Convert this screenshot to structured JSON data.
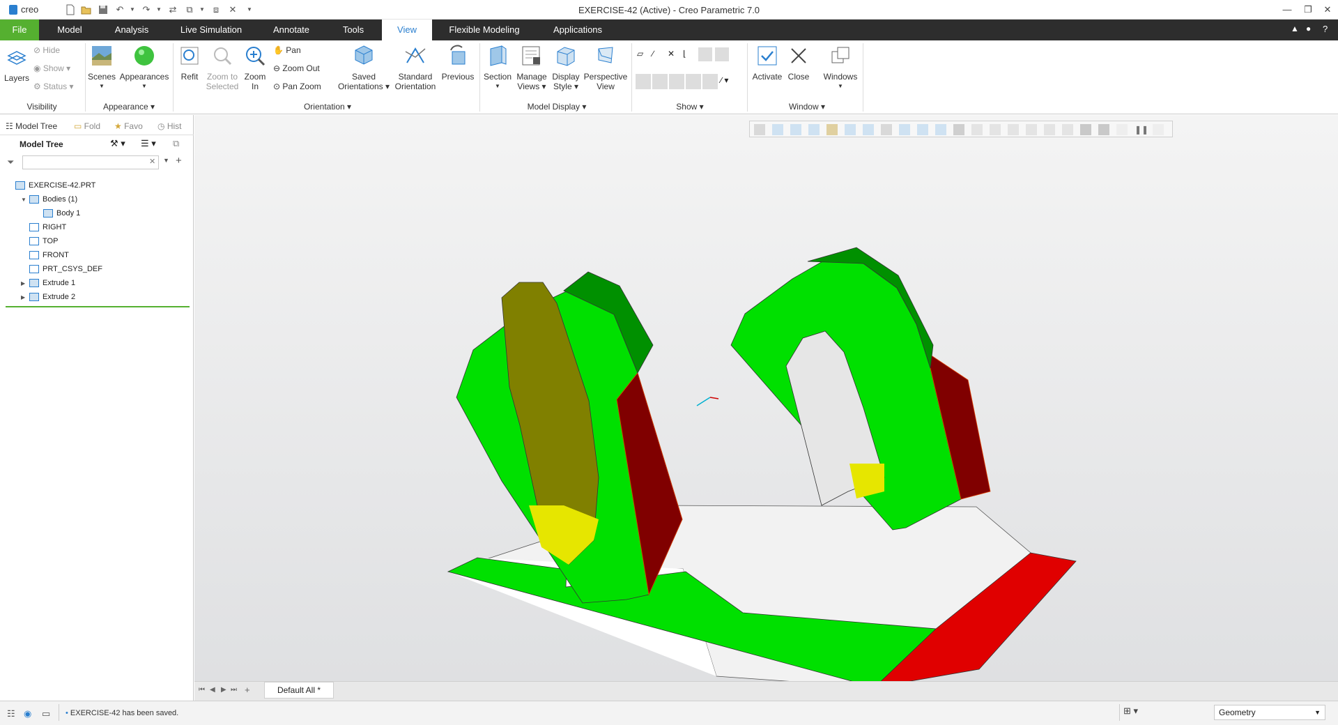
{
  "app": {
    "title": "EXERCISE-42 (Active) - Creo Parametric 7.0",
    "logo": "creo",
    "accent": "#55b030"
  },
  "menu": {
    "tabs": [
      "File",
      "Model",
      "Analysis",
      "Live Simulation",
      "Annotate",
      "Tools",
      "View",
      "Flexible Modeling",
      "Applications"
    ],
    "active": "View"
  },
  "ribbon": {
    "visibility": {
      "layers": "Layers",
      "hide": "Hide",
      "show": "Show",
      "status": "Status",
      "group": "Visibility"
    },
    "appearance": {
      "scenes": "Scenes",
      "appearances": "Appearances",
      "group": "Appearance"
    },
    "orientation": {
      "refit": "Refit",
      "zoom_sel_1": "Zoom to",
      "zoom_sel_2": "Selected",
      "zoom_in_1": "Zoom",
      "zoom_in_2": "In",
      "pan": "Pan",
      "zoom_out": "Zoom Out",
      "pan_zoom": "Pan Zoom",
      "saved_1": "Saved",
      "saved_2": "Orientations",
      "standard_1": "Standard",
      "standard_2": "Orientation",
      "previous": "Previous",
      "group": "Orientation"
    },
    "model_display": {
      "section": "Section",
      "manage_1": "Manage",
      "manage_2": "Views",
      "display_1": "Display",
      "display_2": "Style",
      "persp_1": "Perspective",
      "persp_2": "View",
      "group": "Model Display"
    },
    "show": {
      "group": "Show"
    },
    "window": {
      "activate": "Activate",
      "close": "Close",
      "windows": "Windows",
      "group": "Window"
    }
  },
  "left_panel": {
    "tabs": [
      "Model Tree",
      "Fold",
      "Favo",
      "Hist"
    ],
    "title": "Model Tree",
    "search_placeholder": "",
    "tree": [
      {
        "label": "EXERCISE-42.PRT",
        "icon": "part-icon",
        "indent": 0,
        "expander": ""
      },
      {
        "label": "Bodies (1)",
        "icon": "bodies-icon",
        "indent": 1,
        "expander": "▼"
      },
      {
        "label": "Body 1",
        "icon": "body-icon",
        "indent": 2,
        "expander": ""
      },
      {
        "label": "RIGHT",
        "icon": "datum-plane-icon",
        "indent": 1,
        "expander": ""
      },
      {
        "label": "TOP",
        "icon": "datum-plane-icon",
        "indent": 1,
        "expander": ""
      },
      {
        "label": "FRONT",
        "icon": "datum-plane-icon",
        "indent": 1,
        "expander": ""
      },
      {
        "label": "PRT_CSYS_DEF",
        "icon": "csys-icon",
        "indent": 1,
        "expander": ""
      },
      {
        "label": "Extrude 1",
        "icon": "extrude-icon",
        "indent": 1,
        "expander": "▶"
      },
      {
        "label": "Extrude 2",
        "icon": "extrude-icon",
        "indent": 1,
        "expander": "▶"
      }
    ]
  },
  "bottom": {
    "sheet_tab": "Default All *"
  },
  "status": {
    "message": "EXERCISE-42 has been saved.",
    "filter": "Geometry"
  },
  "colors": {
    "green": "#00e000",
    "dark_green": "#009000",
    "dark_red": "#800000",
    "red": "#e00000",
    "yellow": "#e6e600",
    "olive": "#808000",
    "base_top": "#f2f2f2"
  }
}
